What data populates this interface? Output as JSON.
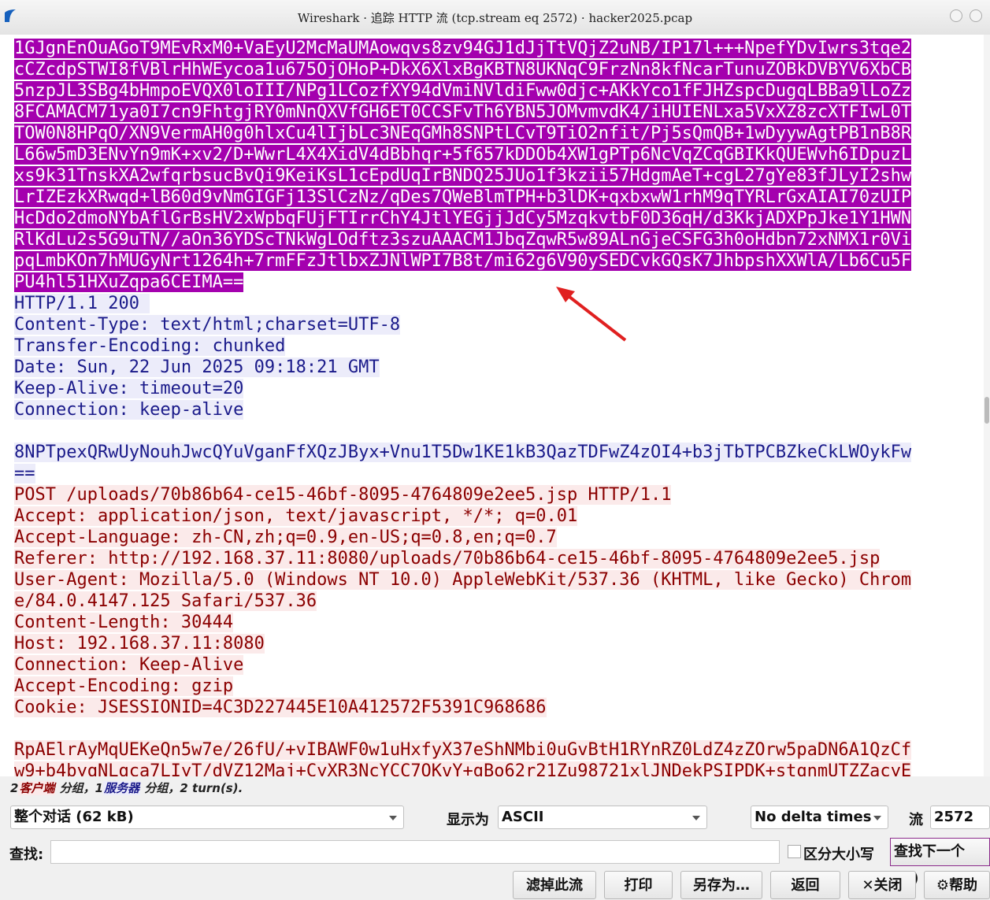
{
  "window": {
    "title": "Wireshark · 追踪 HTTP 流 (tcp.stream eq 2572) · hacker2025.pcap"
  },
  "stream": {
    "server_selected_lines": [
      "1GJgnEnOuAGoT9MEvRxM0+VaEyU2McMaUMAowqvs8zv94GJ1dJjTtVQjZ2uNB/IP17l+++NpefYDvIwrs3tqe2",
      "cCZcdpSTWI8fVBlrHhWEycoa1u675OjOHoP+DkX6XlxBgKBTN8UKNqC9FrzNn8kfNcarTunuZOBkDVBYV6XbCB",
      "5nzpJL3SBg4bHmpoEVQX0loIII/NPg1LCozfXY94dVmiNVldiFww0djc+AKkYco1fFJHZspcDugqLBBa9lLoZz",
      "8FCAMACM71ya0I7cn9FhtgjRY0mNnQXVfGH6ET0CCSFvTh6YBN5JOMvmvdK4/iHUIENLxa5VxXZ8zcXTFIwL0T",
      "TOW0N8HPqO/XN9VermAH0g0hlxCu4lIjbLc3NEqGMh8SNPtLCvT9TiO2nfit/Pj5sQmQB+1wDyywAgtPB1nB8R",
      "L66w5mD3ENvYn9mK+xv2/D+WwrL4X4XidV4dBbhqr+5f657kDDOb4XW1gPTp6NcVqZCqGBIKkQUEWvh6IDpuzL",
      "xs9k31TnskXA2wfqrbsucBvQi9KeiKsL1cEpdUqIrBNDQ25JUo1f3kzii57HdgmAeT+cgL27gYe83fJLyI2shw",
      "LrIZEzkXRwqd+lB60d9vNmGIGFj13SlCzNz/qDes7QWeBlmTPH+b3lDK+qxbxwW1rhM9qTYRLrGxAIAI70zUIP",
      "HcDdo2dmoNYbAflGrBsHV2xWpbqFUjFTIrrChY4JtlYEGjjJdCy5MzqkvtbF0D36qH/d3KkjADXPpJke1Y1HWN",
      "RlKdLu2s5G9uTN//aOn36YDScTNkWgLOdftz3szuAAACM1JbqZqwR5w89ALnGjeCSFG3h0oHdbn72xNMX1r0Vi",
      "pqLmbKOn7hMUGyNrt1264h+7rmFFzJtlbxZJNlWPI7B8t/mi62g6V90ySEDCvkGQsK7JhbpshXXWlA/Lb6Cu5F",
      "PU4hl51HXuZqpa6CEIMA=="
    ],
    "server_header_lines": [
      "HTTP/1.1 200 ",
      "Content-Type: text/html;charset=UTF-8",
      "Transfer-Encoding: chunked",
      "Date: Sun, 22 Jun 2025 09:18:21 GMT",
      "Keep-Alive: timeout=20",
      "Connection: keep-alive"
    ],
    "server_body_lines": [
      "8NPTpexQRwUyNouhJwcQYuVganFfXQzJByx+Vnu1T5Dw1KE1kB3QazTDFwZ4zOI4+b3jTbTPCBZkeCkLWOykFw",
      "=="
    ],
    "client_header_lines": [
      "POST /uploads/70b86b64-ce15-46bf-8095-4764809e2ee5.jsp HTTP/1.1",
      "Accept: application/json, text/javascript, */*; q=0.01",
      "Accept-Language: zh-CN,zh;q=0.9,en-US;q=0.8,en;q=0.7",
      "Referer: http://192.168.37.11:8080/uploads/70b86b64-ce15-46bf-8095-4764809e2ee5.jsp",
      "User-Agent: Mozilla/5.0 (Windows NT 10.0) AppleWebKit/537.36 (KHTML, like Gecko) Chrom",
      "e/84.0.4147.125 Safari/537.36",
      "Content-Length: 30444",
      "Host: 192.168.37.11:8080",
      "Connection: Keep-Alive",
      "Accept-Encoding: gzip",
      "Cookie: JSESSIONID=4C3D227445E10A412572F5391C968686"
    ],
    "client_body_lines": [
      "RpAElrAyMqUEKeQn5w7e/26fU/+vIBAWF0w1uHxfyX37eShNMbi0uGvBtH1RYnRZ0LdZ4zZOrw5paDN6A1QzCf",
      "w9+b4byqNLqca7LIyT/dVZ12Maj+CyXR3NcYCC7OKvY+gBo62r21Zu98721xlJNDekPSIPDK+stqnmUTZZacyE"
    ]
  },
  "summary": {
    "client_count": "2",
    "client_label": "客户端",
    "mid_text": " 分组，1",
    "server_label": "服务器",
    "end_text": " 分组，2 turn(s)."
  },
  "controls": {
    "conversation_value": "整个对话 (62 kB)",
    "show_as_label": "显示为",
    "show_as_value": "ASCII",
    "delta_value": "No delta times",
    "stream_label": "流",
    "stream_value": "2572",
    "find_label": "查找:",
    "find_value": "",
    "case_label": "区分大小写",
    "find_next_label": "查找下一个(N)"
  },
  "buttons": {
    "filter_out": "滤掉此流",
    "print": "打印",
    "save_as": "另存为…",
    "back": "返回",
    "close": "关闭",
    "help": "帮助"
  },
  "colors": {
    "selection": "#a400ae",
    "server_bg": "#ececfa",
    "client_bg": "#fbeaea",
    "arrow": "#e02020"
  }
}
